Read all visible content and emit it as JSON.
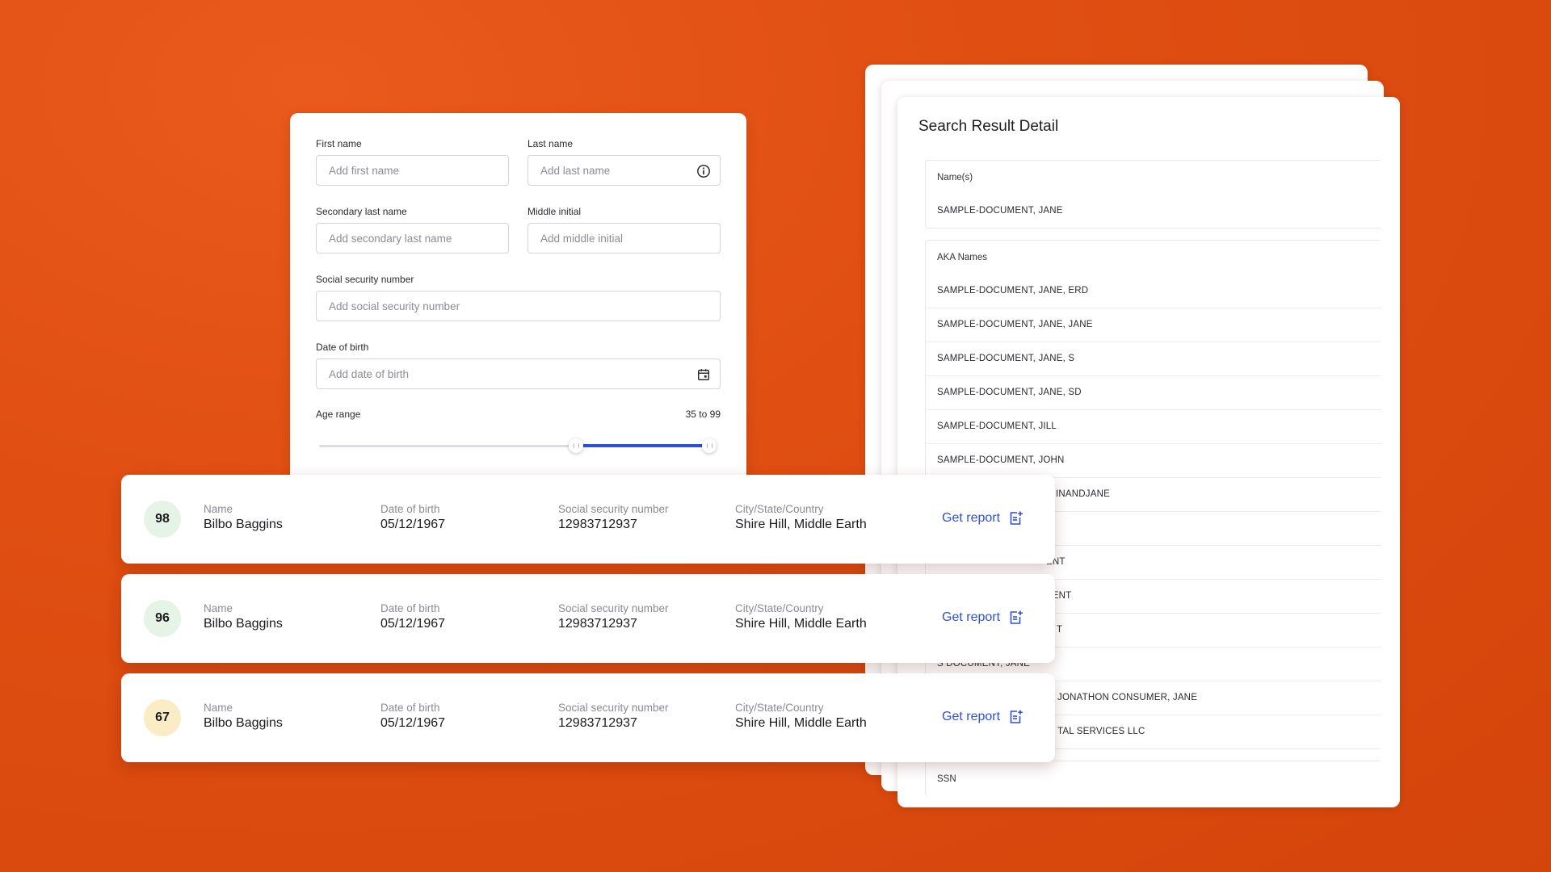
{
  "detail": {
    "title": "Search Result Detail",
    "names_label": "Name(s)",
    "names": [
      "SAMPLE-DOCUMENT, JANE"
    ],
    "aka_label": "AKA Names",
    "aka": [
      "SAMPLE-DOCUMENT, JANE, ERD",
      "SAMPLE-DOCUMENT, JANE, JANE",
      "SAMPLE-DOCUMENT, JANE, S",
      "SAMPLE-DOCUMENT, JANE, SD",
      "SAMPLE-DOCUMENT, JILL",
      "SAMPLE-DOCUMENT, JOHN",
      "INANDJANE",
      "",
      "ENT",
      "MENT",
      "T",
      "S DOCUMENT, JANE",
      "JONATHON CONSUMER, JANE",
      "TAL SERVICES LLC"
    ],
    "ssn_label": "SSN"
  },
  "form": {
    "first_name": {
      "label": "First name",
      "placeholder": "Add first name"
    },
    "last_name": {
      "label": "Last name",
      "placeholder": "Add last name"
    },
    "secondary_last_name": {
      "label": "Secondary last name",
      "placeholder": "Add secondary last name"
    },
    "middle_initial": {
      "label": "Middle initial",
      "placeholder": "Add middle initial"
    },
    "ssn": {
      "label": "Social security number",
      "placeholder": "Add social security number"
    },
    "dob": {
      "label": "Date of birth",
      "placeholder": "Add date of birth"
    },
    "age_range": {
      "label": "Age range",
      "value_text": "35 to 99",
      "min": 35,
      "max": 99
    }
  },
  "results": [
    {
      "score": "98",
      "score_color": "#e6f4e8",
      "name_label": "Name",
      "name": "Bilbo Baggins",
      "dob_label": "Date of birth",
      "dob": "05/12/1967",
      "ssn_label": "Social security number",
      "ssn": "12983712937",
      "loc_label": "City/State/Country",
      "loc": "Shire Hill, Middle Earth",
      "action": "Get report"
    },
    {
      "score": "96",
      "score_color": "#e6f4e8",
      "name_label": "Name",
      "name": "Bilbo Baggins",
      "dob_label": "Date of birth",
      "dob": "05/12/1967",
      "ssn_label": "Social security number",
      "ssn": "12983712937",
      "loc_label": "City/State/Country",
      "loc": "Shire Hill, Middle Earth",
      "action": "Get report"
    },
    {
      "score": "67",
      "score_color": "#faedc6",
      "name_label": "Name",
      "name": "Bilbo Baggins",
      "dob_label": "Date of birth",
      "dob": "05/12/1967",
      "ssn_label": "Social security number",
      "ssn": "12983712937",
      "loc_label": "City/State/Country",
      "loc": "Shire Hill, Middle Earth",
      "action": "Get report"
    }
  ],
  "colors": {
    "accent": "#2e4fd9",
    "background": "#dd4d10"
  }
}
